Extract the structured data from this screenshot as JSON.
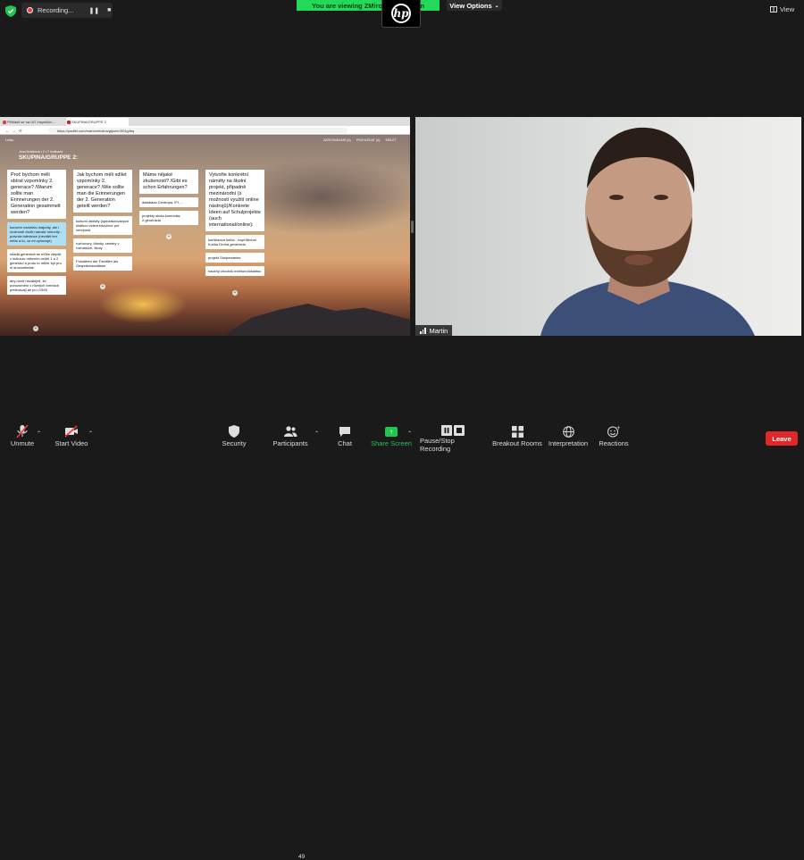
{
  "top": {
    "recording_label": "Recording...",
    "viewing_banner": "You are viewing ZMiroslav's screen",
    "view_options_label": "View Options",
    "view_label": "View"
  },
  "browser": {
    "tabs": [
      "Přihlásit se na UG Inspekční...",
      "SKUPINA/GRUPPE 2"
    ],
    "url": "https://padlet.com/mariomirulina/gtjluhe3f24gdbq"
  },
  "padlet": {
    "header_link": "Lesko",
    "header_right": [
      "ZAROVNÁVÁNÍ (A)",
      "PROHLÉDAT (A)",
      "SDÍLET"
    ],
    "author": "Jana Mráčková • 2 • 7 hodinami",
    "title": "SKUPINA/GRUPPE 2:",
    "columns": [
      {
        "header": "Proč bychom měli sbírat vzpomínky 2. generace? /Warum sollte man Erinnerungen der 2. Generation gesammelt werden?",
        "cards": [
          {
            "text": "koncem narrativu majority, ale i možnosti vložit narrativ minority - potvrda tolerance (nevidět ten nebo a to, co mi vyhovuje)",
            "highlight": true
          },
          {
            "text": "mladá generace se může zlepšit v kulturou mlčením rodiči 1 a 2 generací a proto to může být pro ni srozumitelné",
            "highlight": false
          },
          {
            "text": "aby nově nezabíjeli, že porozumění v různých formách pretrvávají až po r.1945",
            "highlight": false
          }
        ]
      },
      {
        "header": "Jak bychom měli sdílet vzpomínky 2. generace? /Wie sollte man die Erinnerungen der 2. Generation geteilt werden?",
        "cards": [
          {
            "text": "kulturní aktivity (specializovaných institucí videoredovičné pre verejnost",
            "highlight": false
          },
          {
            "text": "rozhovory, články, ceneky v rozhlasích, školy",
            "highlight": false
          },
          {
            "text": "Fotoalben der Familien als Gesprächsanlässe",
            "highlight": false
          }
        ]
      },
      {
        "header": "Máme nějaké zkušenosti? /Gibt es schon Erfahrungen?",
        "cards": [
          {
            "text": "databáza Centropa, IFI, ...",
            "highlight": false
          },
          {
            "text": "projekty skola-komunita-2.generácia",
            "highlight": false
          }
        ]
      },
      {
        "header": "Vytvořte konkrétní náměty na školní projekt, případně mezinárodní (s možností využití online nástrojů)/Konkrete Ideen auf Schulprojekte (auch international/online):",
        "cards": [
          {
            "text": "komiksová kniha - napr.Michal Kočka Druhá generácia",
            "highlight": false
          },
          {
            "text": "projekt Stolpersteine",
            "highlight": false
          },
          {
            "text": "naučný chodník meetom/lokalitou",
            "highlight": false
          }
        ]
      }
    ]
  },
  "video": {
    "participant_name": "Martin"
  },
  "toolbar": {
    "unmute": "Unmute",
    "start_video": "Start Video",
    "security": "Security",
    "participants": "Participants",
    "participants_count": "49",
    "chat": "Chat",
    "share_screen": "Share Screen",
    "pause_stop_recording": "Pause/Stop Recording",
    "breakout_rooms": "Breakout Rooms",
    "interpretation": "Interpretation",
    "reactions": "Reactions",
    "leave": "Leave"
  },
  "colors": {
    "banner_green": "#23d959",
    "share_green": "#23c552",
    "leave_red": "#e02828",
    "recording_red": "#e0413a"
  },
  "icons": [
    "shield-icon",
    "record-dot-icon",
    "pause-icon",
    "stop-icon",
    "hp-logo",
    "grid-view-icon",
    "mic-muted-icon",
    "video-off-icon",
    "security-shield-icon",
    "participants-icon",
    "chat-icon",
    "share-screen-icon",
    "pause-stop-icon",
    "breakout-rooms-icon",
    "globe-icon",
    "reactions-icon"
  ]
}
